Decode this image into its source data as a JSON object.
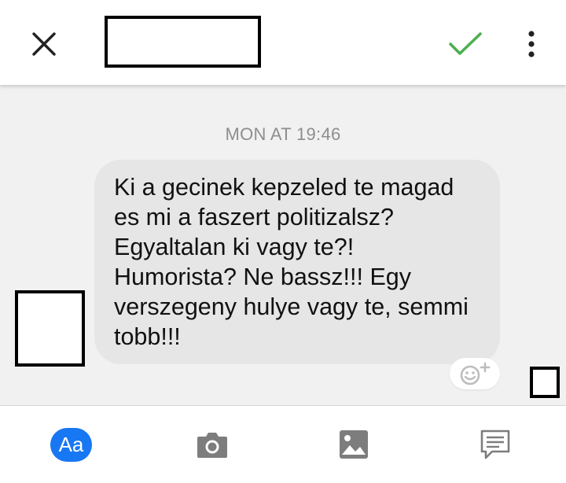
{
  "header": {
    "close_icon": "close-icon",
    "confirm_icon": "checkmark-icon",
    "more_icon": "more-vertical-icon",
    "accent_color": "#4caf50"
  },
  "conversation": {
    "timestamp": "MON AT 19:46",
    "message_lines": [
      "Ki a gecinek kepzeled te magad",
      "es mi a faszert politizalsz?",
      "Egyaltalan ki vagy te?!",
      "Humorista? Ne bassz!!! Egy",
      "verszegeny hulye vagy te, semmi",
      "tobb!!!"
    ],
    "react_icon": "add-reaction-icon"
  },
  "composer": {
    "text_button_label": "Aa",
    "camera_icon": "camera-icon",
    "gallery_icon": "image-icon",
    "chat_icon": "message-icon",
    "brand_color": "#1877f2"
  }
}
